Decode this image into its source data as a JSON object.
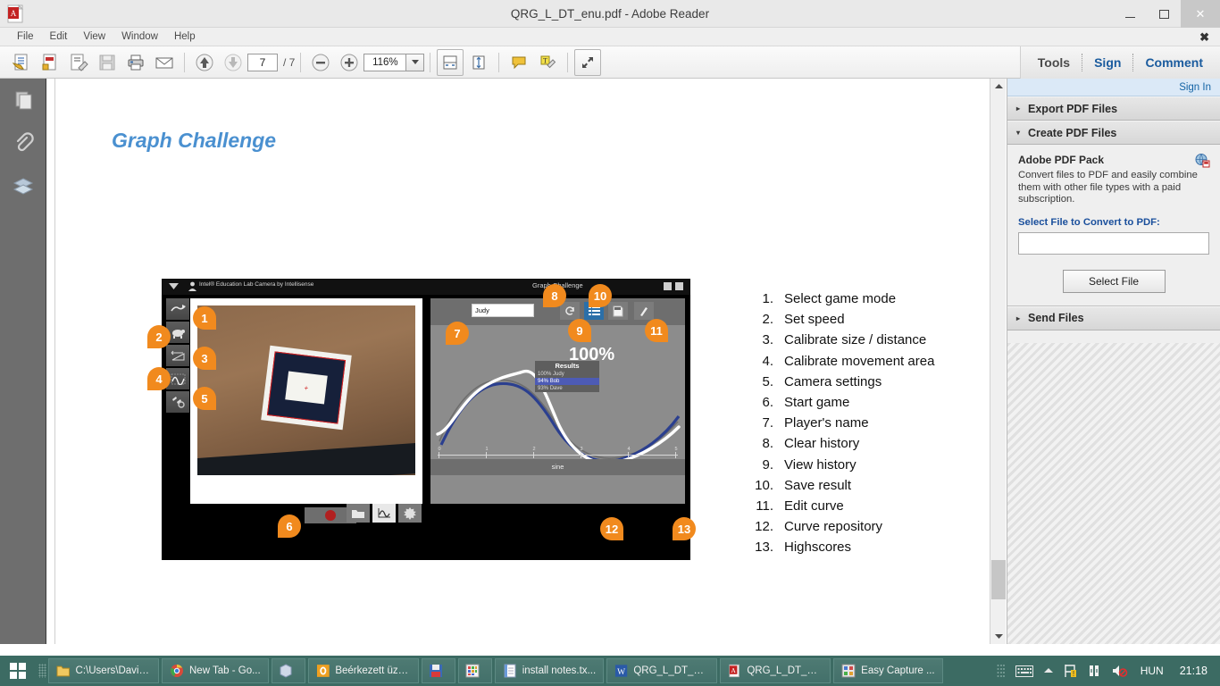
{
  "window": {
    "title": "QRG_L_DT_enu.pdf - Adobe Reader",
    "app_icon": "adobe-reader-icon",
    "minimize": "minimize-icon",
    "maximize": "maximize-icon",
    "close": "close-icon"
  },
  "menubar": {
    "items": [
      "File",
      "Edit",
      "View",
      "Window",
      "Help"
    ],
    "close_label": "✖"
  },
  "toolbar": {
    "page_current": "7",
    "page_total": "/ 7",
    "zoom_value": "116%",
    "zoom_caret": "▼",
    "icons": [
      "open-file-icon",
      "create-pdf-icon",
      "edit-pdf-icon",
      "save-icon",
      "print-icon",
      "email-icon",
      "previous-page-icon",
      "next-page-icon",
      "zoom-out-icon",
      "zoom-in-icon",
      "fit-width-icon",
      "fit-page-icon",
      "sticky-note-icon",
      "highlight-text-icon",
      "read-mode-icon"
    ],
    "right_items": [
      "Tools",
      "Sign",
      "Comment"
    ]
  },
  "left_rail": {
    "items": [
      "page-thumbnails-icon",
      "attachments-icon",
      "layers-icon"
    ]
  },
  "document": {
    "heading": "Graph Challenge",
    "list": [
      {
        "n": "1.",
        "text": "Select game mode"
      },
      {
        "n": "2.",
        "text": "Set speed"
      },
      {
        "n": "3.",
        "text": "Calibrate size / distance"
      },
      {
        "n": "4.",
        "text": "Calibrate movement area"
      },
      {
        "n": "5.",
        "text": "Camera settings"
      },
      {
        "n": "6.",
        "text": "Start game"
      },
      {
        "n": "7.",
        "text": "Player's name"
      },
      {
        "n": "8.",
        "text": "Clear history"
      },
      {
        "n": "9.",
        "text": "View history"
      },
      {
        "n": "10.",
        "text": "Save result"
      },
      {
        "n": "11.",
        "text": "Edit curve"
      },
      {
        "n": "12.",
        "text": "Curve repository"
      },
      {
        "n": "13.",
        "text": "Highscores"
      }
    ],
    "figure": {
      "app_title": "Intel® Education Lab Camera by Intellisense",
      "window_title": "Graph Challenge",
      "player_name": "Judy",
      "score_percent": "100%",
      "results_title": "Results",
      "results": [
        {
          "score": "100%",
          "name": "Judy",
          "highlight": false
        },
        {
          "score": "94%",
          "name": "Bob",
          "highlight": true
        },
        {
          "score": "93%",
          "name": "Dave",
          "highlight": false
        }
      ],
      "plot_label": "sine",
      "x_ticks": [
        "0",
        "1",
        "2",
        "3",
        "4",
        "5"
      ],
      "badges": [
        "1",
        "2",
        "3",
        "4",
        "5",
        "6",
        "7",
        "8",
        "9",
        "10",
        "11",
        "12",
        "13"
      ],
      "badge_color": "#f18a1e",
      "left_tools": [
        "game-mode-icon",
        "speed-turtle-icon",
        "calibrate-size-icon",
        "calibrate-area-icon",
        "camera-settings-icon"
      ],
      "record_button": "start-game-record-button",
      "graph_tools": [
        "clear-history-icon",
        "view-history-icon",
        "save-result-icon",
        "edit-curve-icon"
      ],
      "bottom_tools": [
        "curve-repository-icon",
        "curve-preview-icon",
        "highscores-icon"
      ]
    }
  },
  "right_panel": {
    "sign_in": "Sign In",
    "sections": [
      {
        "label": "Export PDF Files",
        "expanded": false,
        "tri": "▸"
      },
      {
        "label": "Create PDF Files",
        "expanded": true,
        "tri": "▾"
      },
      {
        "label": "Send Files",
        "expanded": false,
        "tri": "▸"
      }
    ],
    "create_pdf": {
      "title": "Adobe PDF Pack",
      "description": "Convert files to PDF and easily combine them with other file types with a paid subscription.",
      "link_label": "Select File to Convert to PDF:",
      "input_value": "",
      "input_placeholder": "",
      "button_label": "Select File",
      "icon": "adobe-cloud-globe-icon"
    }
  },
  "scrollbar": {
    "up_arrow": "▲",
    "down_arrow": "▼"
  },
  "taskbar": {
    "start": "windows-start-icon",
    "items": [
      {
        "label": "C:\\Users\\David...",
        "icon": "folder-icon"
      },
      {
        "label": "New Tab - Go...",
        "icon": "chrome-icon"
      },
      {
        "label": "",
        "icon": "store-icon"
      },
      {
        "label": "Beérkezett üze...",
        "icon": "outlook-icon"
      },
      {
        "label": "",
        "icon": "floppy-save-icon"
      },
      {
        "label": "",
        "icon": "calculator-icon"
      },
      {
        "label": "install notes.tx...",
        "icon": "notepad-icon"
      },
      {
        "label": "QRG_L_DT_en...",
        "icon": "word-icon"
      },
      {
        "label": "QRG_L_DT_en...",
        "icon": "adobe-reader-icon"
      },
      {
        "label": "Easy Capture ...",
        "icon": "easy-capture-icon"
      }
    ],
    "tray": {
      "keyboard": "keyboard-icon",
      "show_hidden": "show-hidden-icons-icon",
      "flag": "action-center-flag-icon",
      "network": "network-icon",
      "volume": "volume-muted-icon",
      "language": "HUN",
      "clock": "21:18"
    }
  },
  "colors": {
    "accent_orange": "#f18a1e",
    "heading_blue": "#4a90d0",
    "taskbar": "#3c6b63",
    "link_blue": "#1a4f9c"
  }
}
